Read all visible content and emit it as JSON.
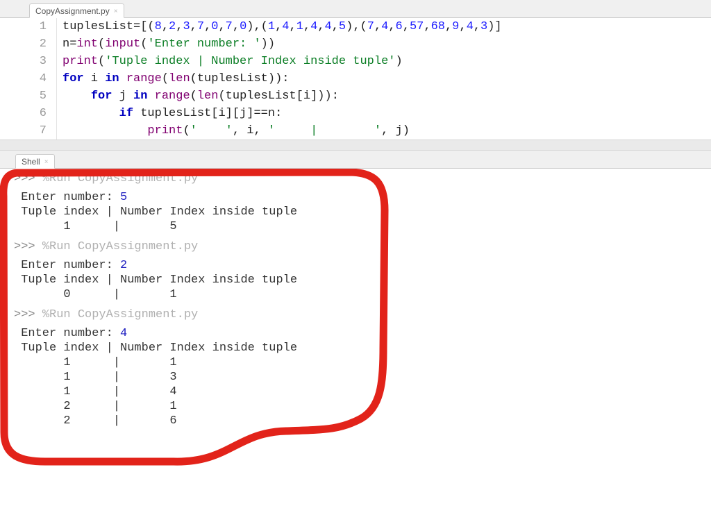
{
  "editor_tab": {
    "label": "CopyAssignment.py"
  },
  "shell_tab": {
    "label": "Shell"
  },
  "code_lines": {
    "l1": {
      "n": "1",
      "s1": "tuplesList",
      "s2": "=[(",
      "s3": ",",
      "s4": "),(",
      "s5": ")]",
      "v1": "8",
      "v2": "2",
      "v3": "3",
      "v4": "7",
      "v5": "0",
      "v6": "7",
      "v7": "0",
      "w1": "1",
      "w2": "4",
      "w3": "1",
      "w4": "4",
      "w5": "4",
      "w6": "5",
      "x1": "7",
      "x2": "4",
      "x3": "6",
      "x4": "57",
      "x5": "68",
      "x6": "9",
      "x7": "4",
      "x8": "3"
    },
    "l2": {
      "n": "2",
      "a": "n",
      "eq": "=",
      "int": "int",
      "op": "(",
      "input": "input",
      "s": "'Enter number: '",
      "cp": "))"
    },
    "l3": {
      "n": "3",
      "print": "print",
      "op": "(",
      "s": "'Tuple index | Number Index inside tuple'",
      "cp": ")"
    },
    "l4": {
      "n": "4",
      "for": "for",
      "i": " i ",
      "in": "in",
      "range": " range",
      "op": "(",
      "len": "len",
      "ident": "(tuplesList)):"
    },
    "l5": {
      "n": "5",
      "ind": "    ",
      "for": "for",
      "j": " j ",
      "in": "in",
      "range": " range",
      "op": "(",
      "len": "len",
      "ident": "(tuplesList[i])):"
    },
    "l6": {
      "n": "6",
      "ind": "        ",
      "if": "if",
      "rest": " tuplesList[i][j]==n:"
    },
    "l7": {
      "n": "7",
      "ind": "            ",
      "print": "print",
      "op": "(",
      "s1": "'    '",
      "c": ", i, ",
      "s2": "'     |        '",
      "c2": ", j)",
      "cp": ""
    }
  },
  "shell_runs": [
    {
      "cmd": "%Run CopyAssignment.py",
      "enter": "Enter number: ",
      "enter_val": "5",
      "hdr": "Tuple index | Number Index inside tuple",
      "rows": [
        [
          "      1      |",
          "       5"
        ]
      ]
    },
    {
      "cmd": "%Run CopyAssignment.py",
      "enter": "Enter number: ",
      "enter_val": "2",
      "hdr": "Tuple index | Number Index inside tuple",
      "rows": [
        [
          "      0      |",
          "       1"
        ]
      ]
    },
    {
      "cmd": "%Run CopyAssignment.py",
      "enter": "Enter number: ",
      "enter_val": "4",
      "hdr": "Tuple index | Number Index inside tuple",
      "rows": [
        [
          "      1      |",
          "       1"
        ],
        [
          "      1      |",
          "       3"
        ],
        [
          "      1      |",
          "       4"
        ],
        [
          "      2      |",
          "       1"
        ],
        [
          "      2      |",
          "       6"
        ]
      ]
    }
  ],
  "prompt": ">>> "
}
